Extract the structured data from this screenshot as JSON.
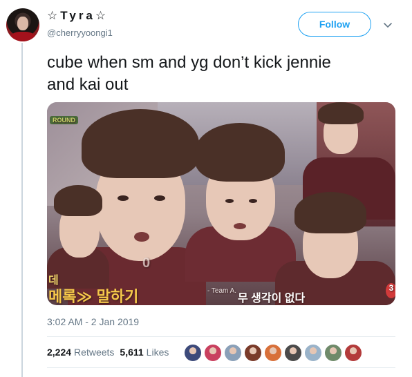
{
  "user": {
    "display_name": "☆Tyra☆",
    "handle": "@cherryyoongi1"
  },
  "actions": {
    "follow_label": "Follow",
    "more_icon": "chevron-down-icon"
  },
  "tweet": {
    "text_line1": "cube when sm and yg don’t kick jennie",
    "text_line2": "and kai out",
    "timestamp": "3:02 AM - 2 Jan 2019"
  },
  "media": {
    "caption_left": "메록≫ 말하기",
    "caption_left_small": "데",
    "caption_right": "무 생각이 없다",
    "caption_team": "- Team A.",
    "caption_score": "3",
    "caption_zero": "0",
    "caption_logo": "ROUND"
  },
  "stats": {
    "retweets_count": "2,224",
    "retweets_label": "Retweets",
    "likes_count": "5,611",
    "likes_label": "Likes"
  },
  "colors": {
    "accent": "#1da1f2",
    "secondary_text": "#657786",
    "liker_avatars": [
      "#3d4a7a",
      "#c9405f",
      "#8aa0b8",
      "#7a3b2a",
      "#d8703a",
      "#4b4b4b",
      "#9ab3c9",
      "#6f8a6a",
      "#b33b3b"
    ]
  }
}
